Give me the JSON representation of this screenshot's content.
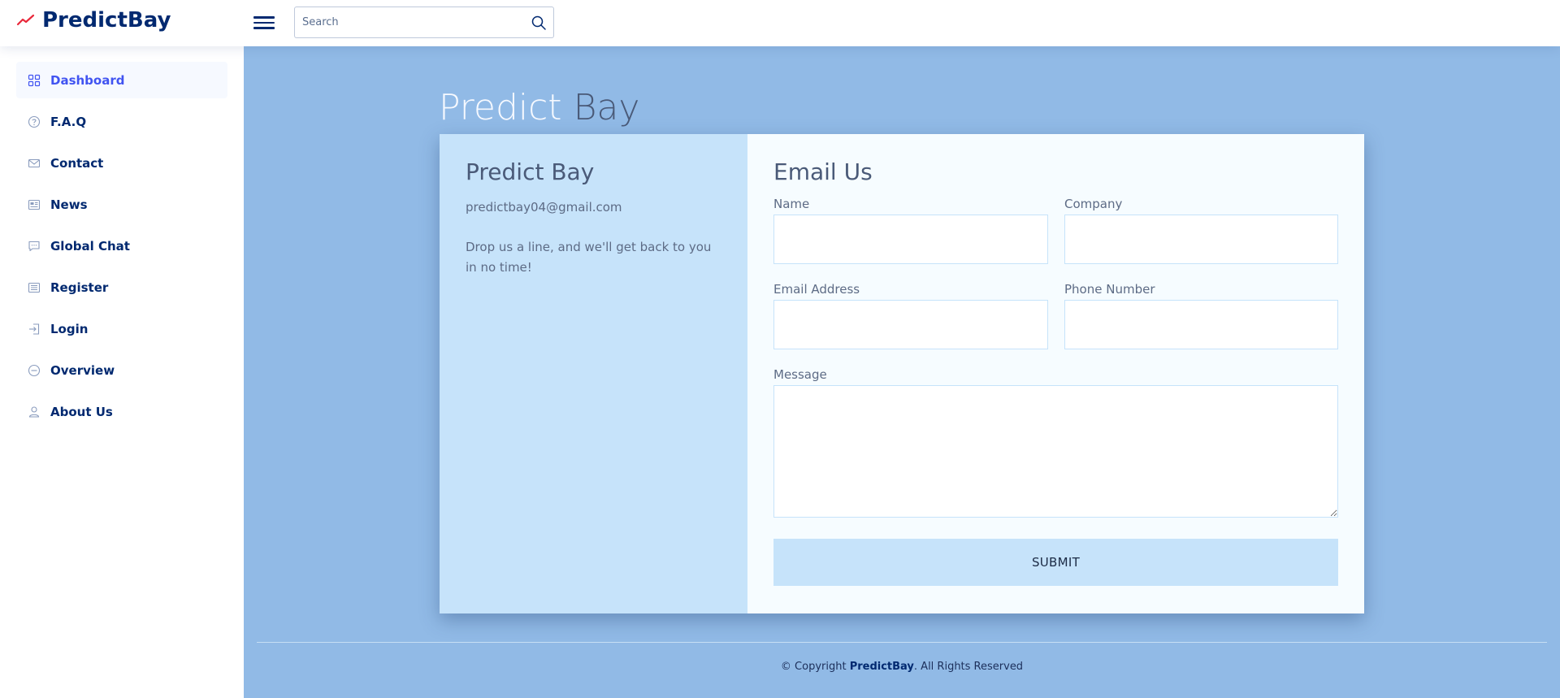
{
  "header": {
    "logo_text": "PredictBay",
    "search_placeholder": "Search"
  },
  "sidebar": {
    "items": [
      {
        "label": "Dashboard",
        "icon": "grid-icon",
        "active": true
      },
      {
        "label": "F.A.Q",
        "icon": "question-circle-icon"
      },
      {
        "label": "Contact",
        "icon": "envelope-icon"
      },
      {
        "label": "News",
        "icon": "newspaper-icon"
      },
      {
        "label": "Global Chat",
        "icon": "chat-icon"
      },
      {
        "label": "Register",
        "icon": "card-list-icon"
      },
      {
        "label": "Login",
        "icon": "box-arrow-in-right-icon"
      },
      {
        "label": "Overview",
        "icon": "dash-circle-icon"
      },
      {
        "label": "About Us",
        "icon": "person-icon"
      }
    ]
  },
  "main": {
    "title_part1": "Predict",
    "title_part2": "Bay",
    "info": {
      "heading": "Predict Bay",
      "email": "predictbay04@gmail.com",
      "note": "Drop us a line, and we'll get back to you in no time!"
    },
    "form": {
      "heading": "Email Us",
      "name_label": "Name",
      "company_label": "Company",
      "email_label": "Email Address",
      "phone_label": "Phone Number",
      "message_label": "Message",
      "submit_label": "SUBMIT"
    }
  },
  "footer": {
    "prefix": "© Copyright ",
    "brand": "PredictBay",
    "suffix": ". All Rights Reserved"
  },
  "colors": {
    "brand": "#012970",
    "accent": "#4154f1",
    "main_bg": "#91bae6",
    "card_left_bg": "#c6e3fa",
    "logo_red": "#e9283a"
  }
}
